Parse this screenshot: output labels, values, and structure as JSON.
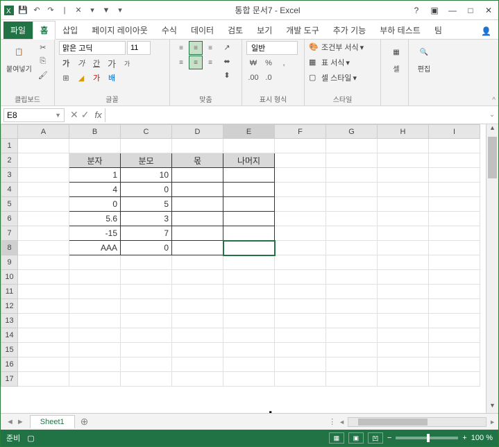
{
  "title": "통합 문서7 - Excel",
  "tabs": {
    "file": "파일",
    "home": "홈",
    "insert": "삽입",
    "layout": "페이지 레이아웃",
    "formulas": "수식",
    "data": "데이터",
    "review": "검토",
    "view": "보기",
    "dev": "개발 도구",
    "addons": "추가 기능",
    "load": "부하 테스트",
    "team": "팀"
  },
  "ribbon": {
    "clipboard": {
      "label": "클립보드",
      "paste": "붙여넣기"
    },
    "font": {
      "label": "글꼴",
      "name": "맑은 고딕",
      "size": "11",
      "bold": "가",
      "italic": "가",
      "underline": "간",
      "grow": "가",
      "shrink": "가"
    },
    "align": {
      "label": "맞춤"
    },
    "number": {
      "label": "표시 형식",
      "format": "일반"
    },
    "styles": {
      "label": "스타일",
      "cond": "조건부 서식",
      "table": "표 서식",
      "cell": "셀 스타일"
    },
    "cells": {
      "label": "셀"
    },
    "editing": {
      "label": "편집"
    }
  },
  "namebox": "E8",
  "columns": [
    "A",
    "B",
    "C",
    "D",
    "E",
    "F",
    "G",
    "H",
    "I"
  ],
  "rows": [
    "1",
    "2",
    "3",
    "4",
    "5",
    "6",
    "7",
    "8",
    "9",
    "10",
    "11",
    "12",
    "13",
    "14",
    "15",
    "16",
    "17"
  ],
  "chart_data": {
    "type": "table",
    "headers": [
      "분자",
      "분모",
      "몫",
      "나머지"
    ],
    "rows": [
      [
        "1",
        "10",
        "",
        ""
      ],
      [
        "4",
        "0",
        "",
        ""
      ],
      [
        "0",
        "5",
        "",
        ""
      ],
      [
        "5.6",
        "3",
        "",
        ""
      ],
      [
        "-15",
        "7",
        "",
        ""
      ],
      [
        "AAA",
        "0",
        "",
        ""
      ]
    ]
  },
  "sheetTab": "Sheet1",
  "status": {
    "ready": "준비",
    "zoom": "100 %"
  }
}
